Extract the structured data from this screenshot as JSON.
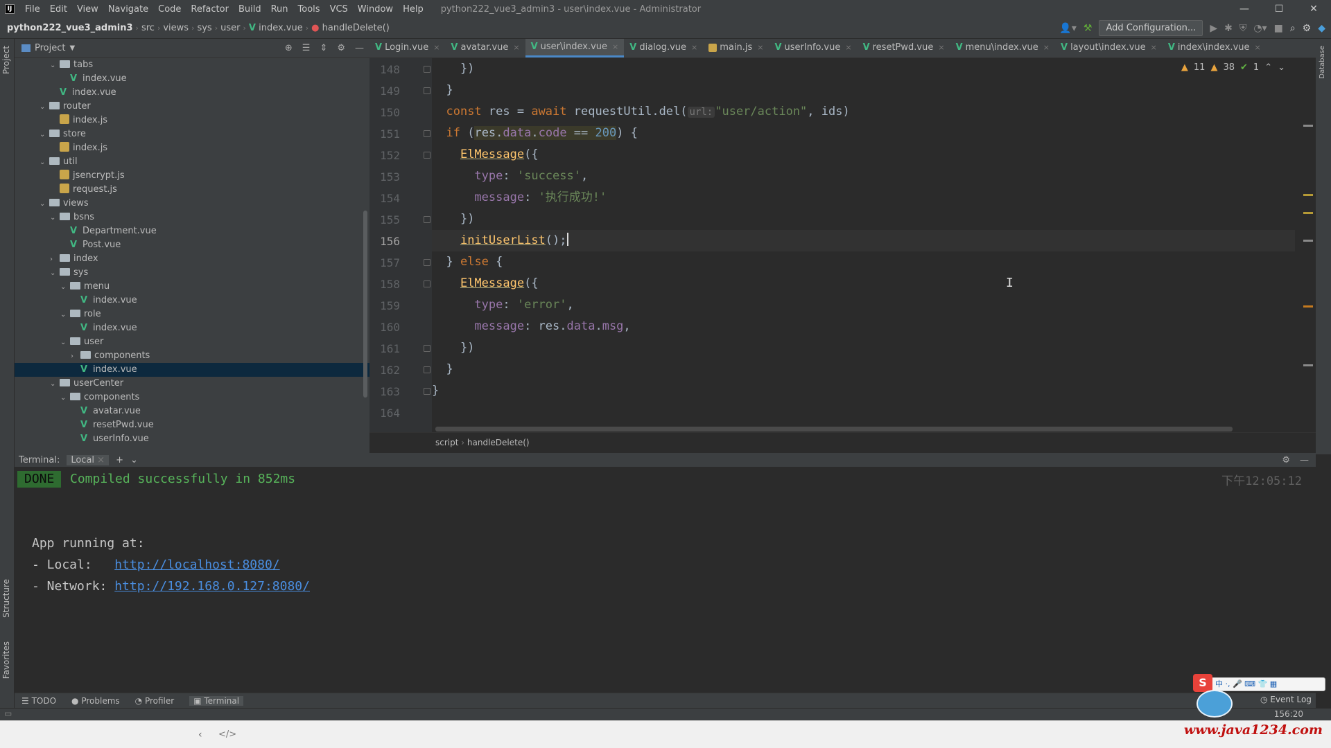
{
  "app": {
    "window_title": "python222_vue3_admin3 - user\\index.vue - Administrator",
    "menu": [
      "File",
      "Edit",
      "View",
      "Navigate",
      "Code",
      "Refactor",
      "Build",
      "Run",
      "Tools",
      "VCS",
      "Window",
      "Help"
    ],
    "logo_letter": "IJ"
  },
  "navbar": {
    "project": "python222_vue3_admin3",
    "crumbs": [
      "src",
      "views",
      "sys",
      "user",
      "index.vue",
      "handleDelete()"
    ],
    "add_config": "Add Configuration..."
  },
  "sidebar": {
    "project_label": "Project",
    "structure_label": "Structure",
    "favorites_label": "Favorites",
    "tree": [
      {
        "name": "tabs",
        "type": "folder",
        "depth": 3,
        "open": true
      },
      {
        "name": "index.vue",
        "type": "vue",
        "depth": 4
      },
      {
        "name": "index.vue",
        "type": "vue",
        "depth": 3
      },
      {
        "name": "router",
        "type": "folder",
        "depth": 2,
        "open": true
      },
      {
        "name": "index.js",
        "type": "js",
        "depth": 3
      },
      {
        "name": "store",
        "type": "folder",
        "depth": 2,
        "open": true
      },
      {
        "name": "index.js",
        "type": "js",
        "depth": 3
      },
      {
        "name": "util",
        "type": "folder",
        "depth": 2,
        "open": true
      },
      {
        "name": "jsencrypt.js",
        "type": "js",
        "depth": 3
      },
      {
        "name": "request.js",
        "type": "js",
        "depth": 3
      },
      {
        "name": "views",
        "type": "folder",
        "depth": 2,
        "open": true
      },
      {
        "name": "bsns",
        "type": "folder",
        "depth": 3,
        "open": true
      },
      {
        "name": "Department.vue",
        "type": "vue",
        "depth": 4
      },
      {
        "name": "Post.vue",
        "type": "vue",
        "depth": 4
      },
      {
        "name": "index",
        "type": "folder",
        "depth": 3,
        "open": false
      },
      {
        "name": "sys",
        "type": "folder",
        "depth": 3,
        "open": true
      },
      {
        "name": "menu",
        "type": "folder",
        "depth": 4,
        "open": true
      },
      {
        "name": "index.vue",
        "type": "vue",
        "depth": 5
      },
      {
        "name": "role",
        "type": "folder",
        "depth": 4,
        "open": true
      },
      {
        "name": "index.vue",
        "type": "vue",
        "depth": 5
      },
      {
        "name": "user",
        "type": "folder",
        "depth": 4,
        "open": true
      },
      {
        "name": "components",
        "type": "folder",
        "depth": 5,
        "open": false
      },
      {
        "name": "index.vue",
        "type": "vue",
        "depth": 5,
        "selected": true
      },
      {
        "name": "userCenter",
        "type": "folder",
        "depth": 3,
        "open": true
      },
      {
        "name": "components",
        "type": "folder",
        "depth": 4,
        "open": true
      },
      {
        "name": "avatar.vue",
        "type": "vue",
        "depth": 5
      },
      {
        "name": "resetPwd.vue",
        "type": "vue",
        "depth": 5
      },
      {
        "name": "userInfo.vue",
        "type": "vue",
        "depth": 5
      }
    ]
  },
  "tabs": [
    {
      "label": "Login.vue",
      "type": "vue"
    },
    {
      "label": "avatar.vue",
      "type": "vue"
    },
    {
      "label": "user\\index.vue",
      "type": "vue",
      "active": true
    },
    {
      "label": "dialog.vue",
      "type": "vue"
    },
    {
      "label": "main.js",
      "type": "js"
    },
    {
      "label": "userInfo.vue",
      "type": "vue"
    },
    {
      "label": "resetPwd.vue",
      "type": "vue"
    },
    {
      "label": "menu\\index.vue",
      "type": "vue"
    },
    {
      "label": "layout\\index.vue",
      "type": "vue"
    },
    {
      "label": "index\\index.vue",
      "type": "vue"
    }
  ],
  "inspections": {
    "warnings": "11",
    "weak": "38",
    "ok": "1"
  },
  "editor": {
    "line_numbers": [
      "148",
      "149",
      "150",
      "151",
      "152",
      "153",
      "154",
      "155",
      "156",
      "157",
      "158",
      "159",
      "160",
      "161",
      "162",
      "163",
      "164"
    ],
    "current_line": "156",
    "breadcrumb": [
      "script",
      "handleDelete()"
    ],
    "code": {
      "l148": "    })",
      "l149": "  }",
      "l150_const": "const",
      "l150_res": " res = ",
      "l150_await": "await",
      "l150_fn": " requestUtil.del(",
      "l150_hint": "url:",
      "l150_str": "\"user/action\"",
      "l150_end": ", ids)",
      "l151_if": "if",
      "l151_cond_a": "res.",
      "l151_cond_b": "data",
      "l151_cond_c": ".",
      "l151_cond_d": "code",
      "l151_cond_e": " == ",
      "l151_num": "200",
      "l151_end": ") {",
      "l152": "ElMessage",
      "l152_end": "({",
      "l153_key": "type",
      "l153_val": "'success'",
      "l154_key": "message",
      "l154_val": "'执行成功!'",
      "l155": "  })",
      "l156": "initUserList",
      "l156_end": "();",
      "l157_a": "} ",
      "l157_else": "else",
      "l157_b": " {",
      "l158": "ElMessage",
      "l158_end": "({",
      "l159_key": "type",
      "l159_val": "'error'",
      "l160_key": "message",
      "l160_a": ": res.",
      "l160_b": "data",
      "l160_c": ".",
      "l160_d": "msg",
      "l161": "  })",
      "l162": "}",
      "l163": "}",
      "l164": ""
    }
  },
  "terminal": {
    "label": "Terminal:",
    "tab": "Local",
    "done": "DONE",
    "compiled": "Compiled successfully in 852ms",
    "time": "下午12:05:12",
    "app_running": "App running at:",
    "local_label": "- Local:   ",
    "local_url": "http://localhost:8080/",
    "network_label": "- Network: ",
    "network_url": "http://192.168.0.127:8080/"
  },
  "bottom_tabs": [
    "TODO",
    "Problems",
    "Profiler",
    "Terminal"
  ],
  "status": {
    "position": "156:20",
    "event_log": "Event Log"
  },
  "watermark": "www.java1234.com"
}
